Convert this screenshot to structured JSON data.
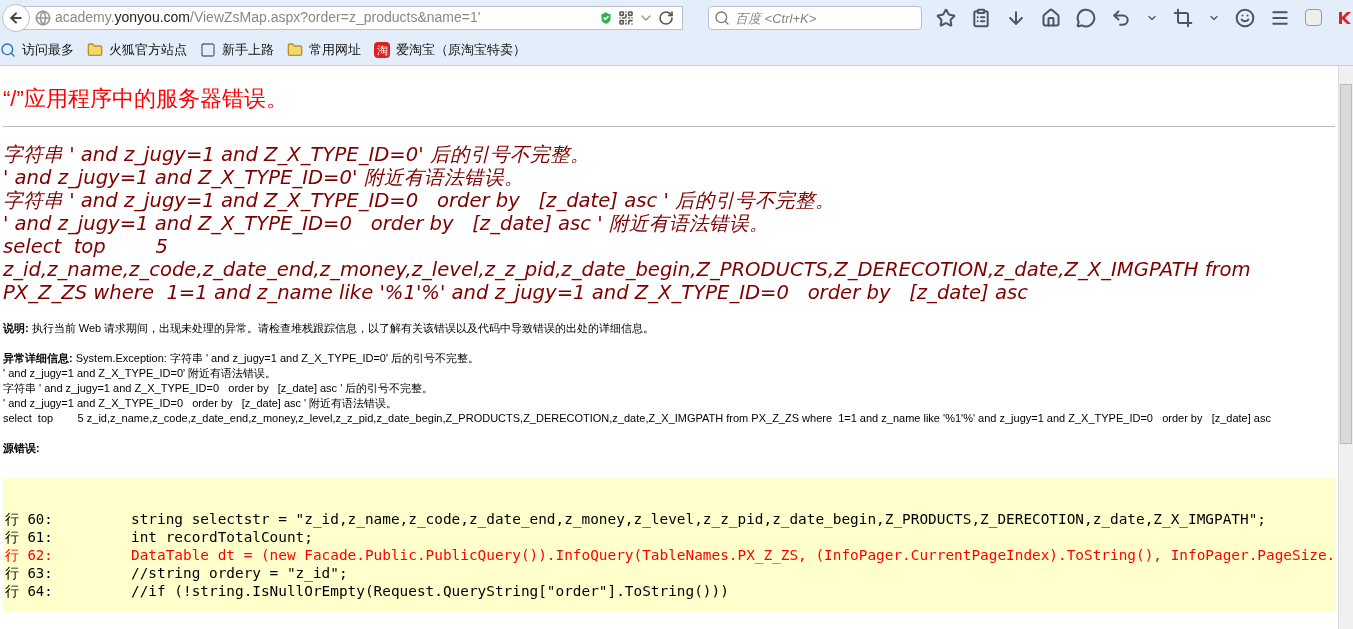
{
  "browser": {
    "url": {
      "subdomain": "academy.",
      "domain": "yonyou.com",
      "path": "/ViewZsMap.aspx?order=z_products&name=1'"
    },
    "search_placeholder": "百度 <Ctrl+K>",
    "bookmarks": [
      {
        "kind": "smart",
        "label": "访问最多"
      },
      {
        "kind": "folder",
        "label": "火狐官方站点"
      },
      {
        "kind": "page",
        "label": "新手上路"
      },
      {
        "kind": "folder",
        "label": "常用网址"
      },
      {
        "kind": "taobao",
        "label": "爱淘宝（原淘宝特卖）",
        "icon_text": "淘"
      }
    ]
  },
  "page": {
    "title": "“/”应用程序中的服务器错误。",
    "error_lines": [
      "字符串 ' and z_jugy=1 and Z_X_TYPE_ID=0' 后的引号不完整。",
      "' and z_jugy=1 and Z_X_TYPE_ID=0' 附近有语法错误。",
      "字符串 ' and z_jugy=1 and Z_X_TYPE_ID=0   order by   [z_date] asc ' 后的引号不完整。",
      "' and z_jugy=1 and Z_X_TYPE_ID=0   order by   [z_date] asc ' 附近有语法错误。",
      "select  top        5",
      "z_id,z_name,z_code,z_date_end,z_money,z_level,z_z_pid,z_date_begin,Z_PRODUCTS,Z_DERECOTION,z_date,Z_X_IMGPATH from",
      "PX_Z_ZS where  1=1 and z_name like '%1'%' and z_jugy=1 and Z_X_TYPE_ID=0   order by   [z_date] asc"
    ],
    "description": {
      "label": "说明:",
      "text": "执行当前 Web 请求期间，出现未处理的异常。请检查堆栈跟踪信息，以了解有关该错误以及代码中导致错误的出处的详细信息。"
    },
    "exception": {
      "label": "异常详细信息:",
      "lines": [
        "System.Exception: 字符串 ' and z_jugy=1 and Z_X_TYPE_ID=0' 后的引号不完整。",
        "' and z_jugy=1 and Z_X_TYPE_ID=0' 附近有语法错误。",
        "字符串 ' and z_jugy=1 and Z_X_TYPE_ID=0   order by   [z_date] asc ' 后的引号不完整。",
        "' and z_jugy=1 and Z_X_TYPE_ID=0   order by   [z_date] asc ' 附近有语法错误。",
        "select  top        5 z_id,z_name,z_code,z_date_end,z_money,z_level,z_z_pid,z_date_begin,Z_PRODUCTS,Z_DERECOTION,z_date,Z_X_IMGPATH from PX_Z_ZS where  1=1 and z_name like '%1'%' and z_jugy=1 and Z_X_TYPE_ID=0   order by   [z_date] asc"
      ]
    },
    "source_error": {
      "label": "源错误:",
      "lines": [
        {
          "number": "行 60:",
          "code": "string selectstr = \"z_id,z_name,z_code,z_date_end,z_money,z_level,z_z_pid,z_date_begin,Z_PRODUCTS,Z_DERECOTION,z_date,Z_X_IMGPATH\";",
          "highlighted": false
        },
        {
          "number": "行 61:",
          "code": "int recordTotalCount;",
          "highlighted": false
        },
        {
          "number": "行 62:",
          "code": "DataTable dt = (new Facade.Public.PublicQuery()).InfoQuery(TableNames.PX_Z_ZS, (InfoPager.CurrentPageIndex).ToString(), InfoPager.PageSize.",
          "highlighted": true
        },
        {
          "number": "行 63:",
          "code": "//string ordery = \"z_id\";",
          "highlighted": false
        },
        {
          "number": "行 64:",
          "code": "//if (!string.IsNullOrEmpty(Request.QueryString[\"order\"].ToString()))",
          "highlighted": false
        }
      ]
    }
  }
}
